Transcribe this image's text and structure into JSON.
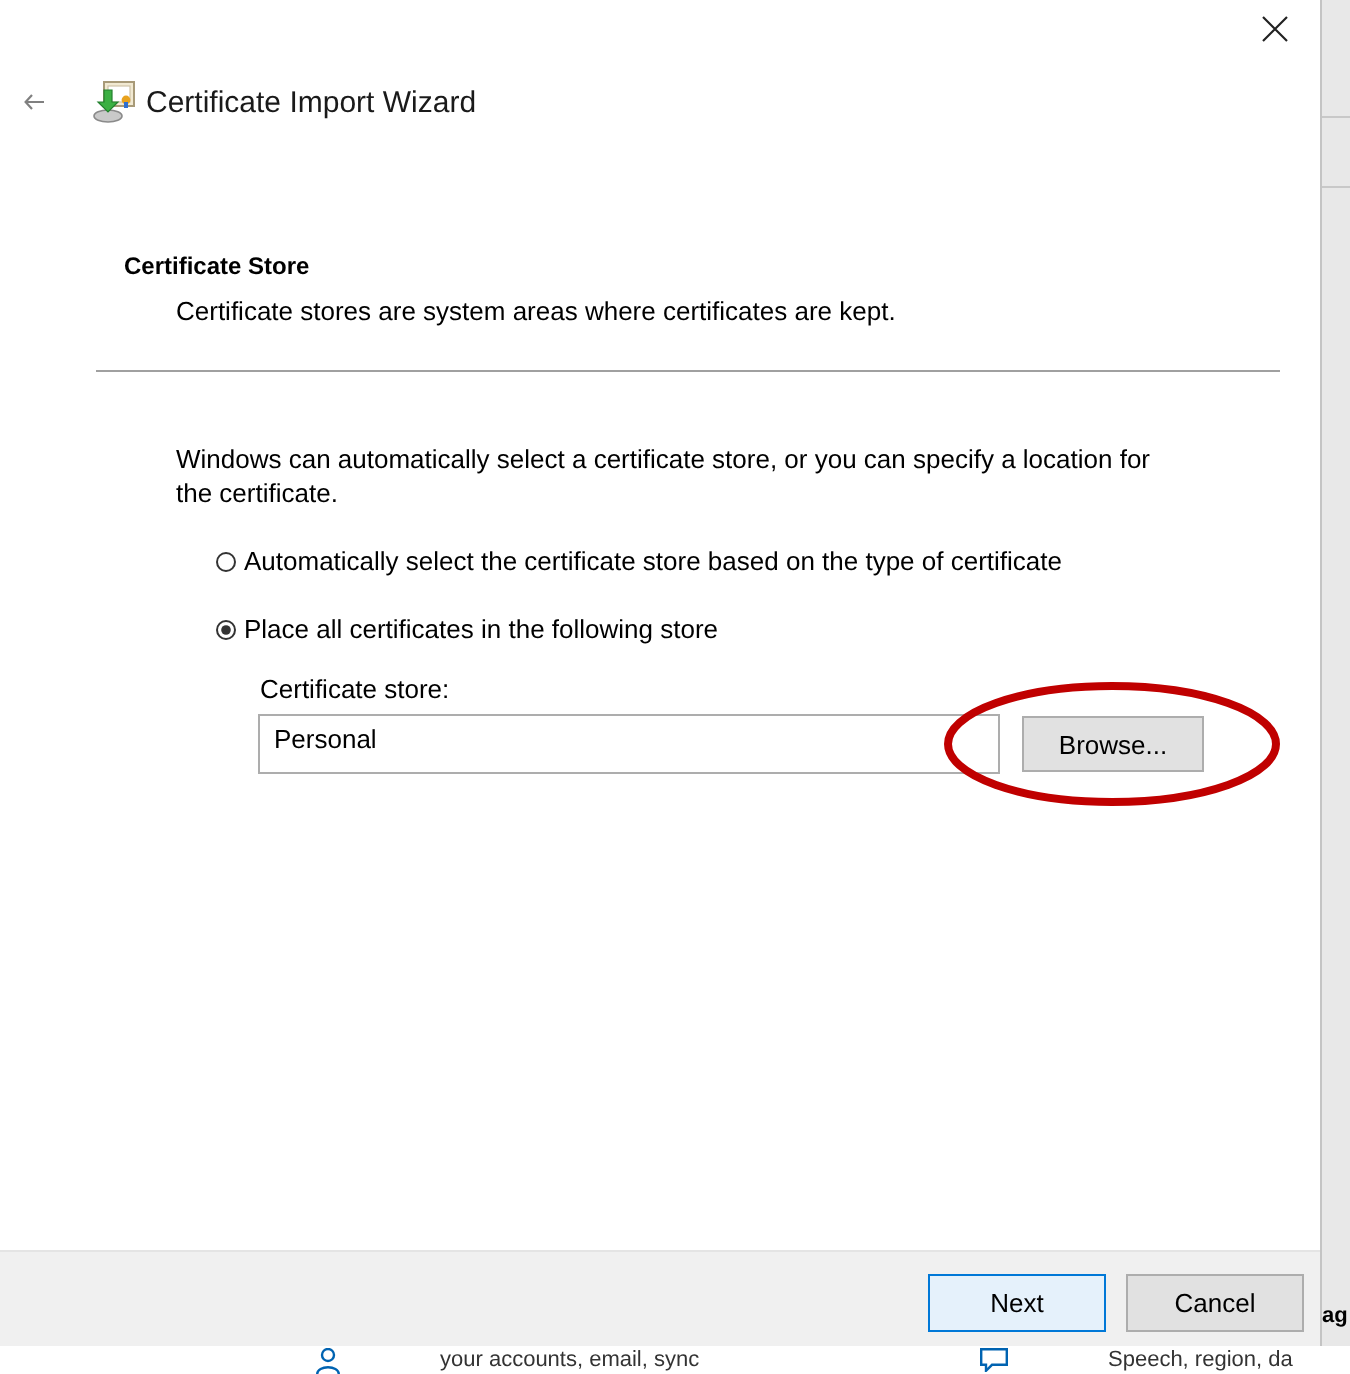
{
  "dialog": {
    "title": "Certificate Import Wizard"
  },
  "header": {
    "title": "Certificate Store",
    "subtitle": "Certificate stores are system areas where certificates are kept."
  },
  "body": {
    "intro": "Windows can automatically select a certificate store, or you can specify a location for the certificate.",
    "options": [
      {
        "label": "Automatically select the certificate store based on the type of certificate",
        "selected": false
      },
      {
        "label": "Place all certificates in the following store",
        "selected": true
      }
    ],
    "store_field": {
      "label": "Certificate store:",
      "value": "Personal"
    },
    "browse_button": {
      "label": "Browse...",
      "highlighted": true
    }
  },
  "footer": {
    "buttons": [
      {
        "label": "Next",
        "kind": "default"
      },
      {
        "label": "Cancel",
        "kind": "normal"
      }
    ]
  },
  "background_window": {
    "heading": "ag",
    "items": [
      {
        "kind": "accounts",
        "text": "your accounts, email, sync"
      },
      {
        "kind": "language",
        "text": "Speech, region, da"
      }
    ]
  }
}
